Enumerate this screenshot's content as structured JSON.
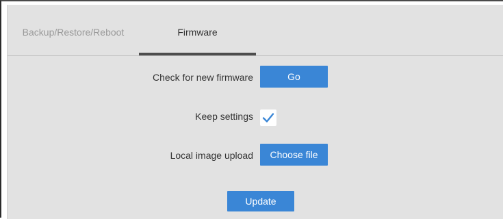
{
  "tabs": [
    {
      "label": "Backup/Restore/Reboot",
      "active": false
    },
    {
      "label": "Firmware",
      "active": true
    }
  ],
  "firmware": {
    "check_label": "Check for new firmware",
    "go_label": "Go",
    "keep_settings_label": "Keep settings",
    "keep_settings_checked": true,
    "upload_label": "Local image upload",
    "choose_file_label": "Choose file",
    "update_label": "Update"
  },
  "colors": {
    "accent": "#3a86d6",
    "panel_background": "#e2e2e2"
  },
  "icons": {
    "checkmark": "check-icon"
  }
}
